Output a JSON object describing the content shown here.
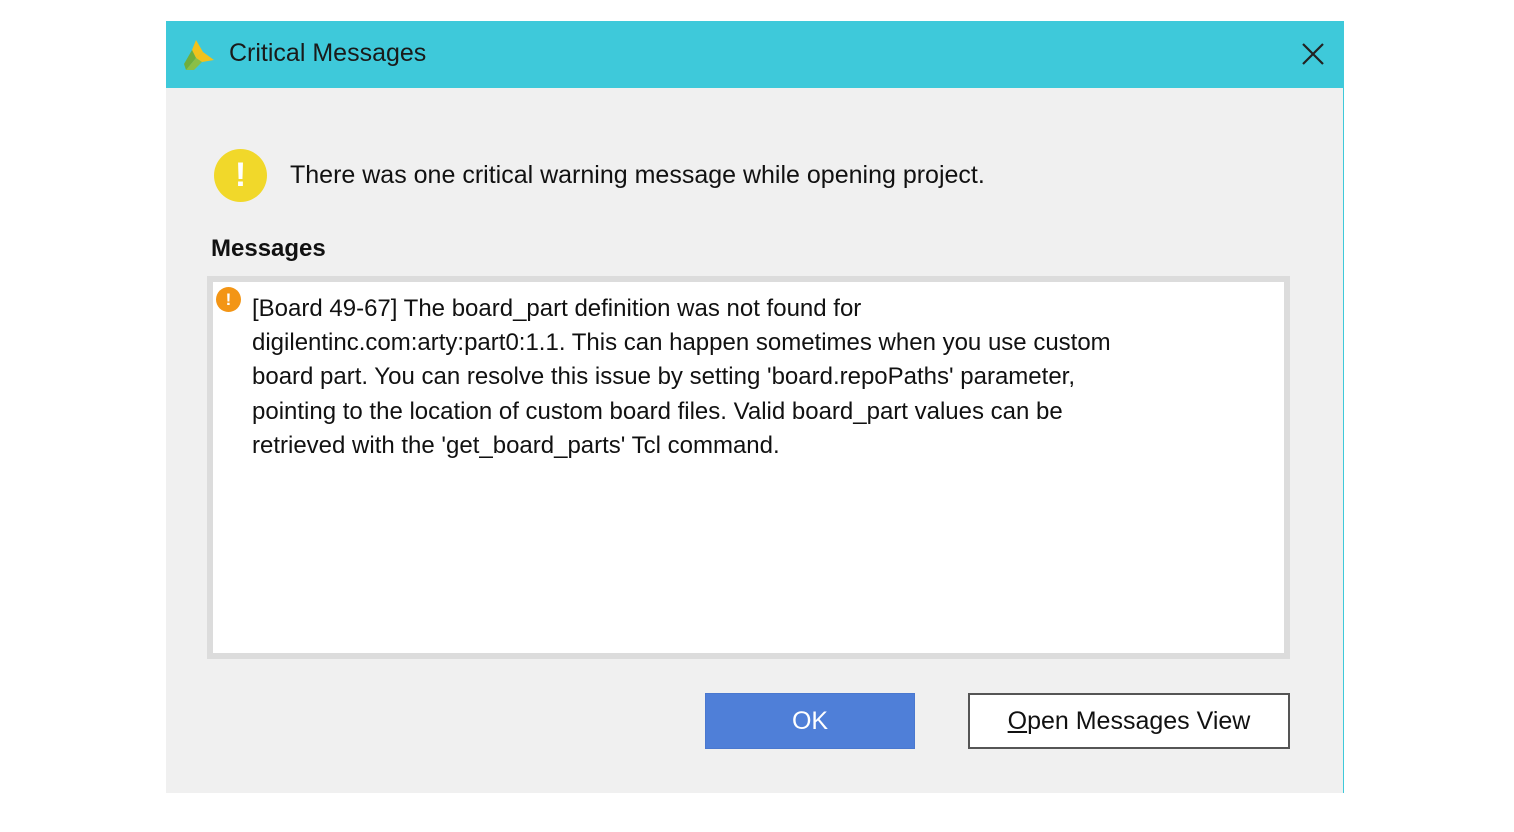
{
  "window": {
    "title": "Critical Messages",
    "logo_icon": "vivado-logo-icon",
    "close_icon": "close-icon",
    "titlebar_color": "#3ec9da"
  },
  "summary": {
    "icon": "warning-icon",
    "text": "There was one critical warning message while opening project."
  },
  "messages": {
    "heading": "Messages",
    "items": [
      {
        "icon": "critical-warning-icon",
        "lines": [
          "[Board 49-67] The board_part definition was not found for",
          "digilentinc.com:arty:part0:1.1. This can happen sometimes when you use custom",
          "board part. You can resolve this issue by setting 'board.repoPaths' parameter,",
          "pointing to the location of custom board files. Valid board_part values can be",
          "retrieved with the 'get_board_parts' Tcl command."
        ]
      }
    ]
  },
  "buttons": {
    "ok_label": "OK",
    "open_messages_label": "Open Messages View"
  },
  "colors": {
    "ok_button": "#4f7fd8",
    "warning": "#f1d82a",
    "critical": "#f39515"
  }
}
